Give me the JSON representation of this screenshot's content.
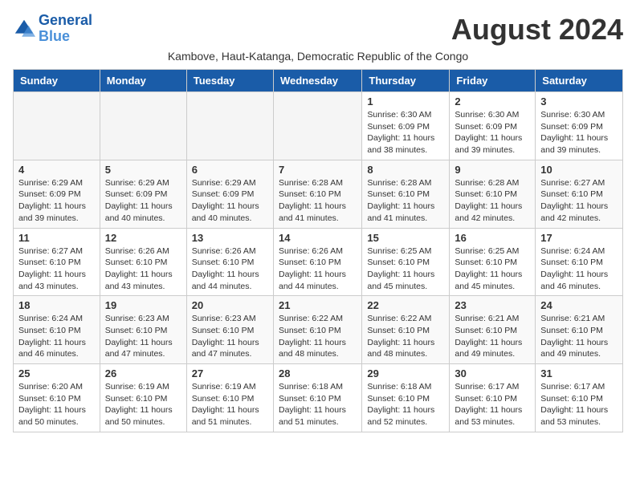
{
  "logo": {
    "line1": "General",
    "line2": "Blue"
  },
  "title": "August 2024",
  "subtitle": "Kambove, Haut-Katanga, Democratic Republic of the Congo",
  "headers": [
    "Sunday",
    "Monday",
    "Tuesday",
    "Wednesday",
    "Thursday",
    "Friday",
    "Saturday"
  ],
  "weeks": [
    [
      {
        "day": "",
        "info": ""
      },
      {
        "day": "",
        "info": ""
      },
      {
        "day": "",
        "info": ""
      },
      {
        "day": "",
        "info": ""
      },
      {
        "day": "1",
        "info": "Sunrise: 6:30 AM\nSunset: 6:09 PM\nDaylight: 11 hours\nand 38 minutes."
      },
      {
        "day": "2",
        "info": "Sunrise: 6:30 AM\nSunset: 6:09 PM\nDaylight: 11 hours\nand 39 minutes."
      },
      {
        "day": "3",
        "info": "Sunrise: 6:30 AM\nSunset: 6:09 PM\nDaylight: 11 hours\nand 39 minutes."
      }
    ],
    [
      {
        "day": "4",
        "info": "Sunrise: 6:29 AM\nSunset: 6:09 PM\nDaylight: 11 hours\nand 39 minutes."
      },
      {
        "day": "5",
        "info": "Sunrise: 6:29 AM\nSunset: 6:09 PM\nDaylight: 11 hours\nand 40 minutes."
      },
      {
        "day": "6",
        "info": "Sunrise: 6:29 AM\nSunset: 6:09 PM\nDaylight: 11 hours\nand 40 minutes."
      },
      {
        "day": "7",
        "info": "Sunrise: 6:28 AM\nSunset: 6:10 PM\nDaylight: 11 hours\nand 41 minutes."
      },
      {
        "day": "8",
        "info": "Sunrise: 6:28 AM\nSunset: 6:10 PM\nDaylight: 11 hours\nand 41 minutes."
      },
      {
        "day": "9",
        "info": "Sunrise: 6:28 AM\nSunset: 6:10 PM\nDaylight: 11 hours\nand 42 minutes."
      },
      {
        "day": "10",
        "info": "Sunrise: 6:27 AM\nSunset: 6:10 PM\nDaylight: 11 hours\nand 42 minutes."
      }
    ],
    [
      {
        "day": "11",
        "info": "Sunrise: 6:27 AM\nSunset: 6:10 PM\nDaylight: 11 hours\nand 43 minutes."
      },
      {
        "day": "12",
        "info": "Sunrise: 6:26 AM\nSunset: 6:10 PM\nDaylight: 11 hours\nand 43 minutes."
      },
      {
        "day": "13",
        "info": "Sunrise: 6:26 AM\nSunset: 6:10 PM\nDaylight: 11 hours\nand 44 minutes."
      },
      {
        "day": "14",
        "info": "Sunrise: 6:26 AM\nSunset: 6:10 PM\nDaylight: 11 hours\nand 44 minutes."
      },
      {
        "day": "15",
        "info": "Sunrise: 6:25 AM\nSunset: 6:10 PM\nDaylight: 11 hours\nand 45 minutes."
      },
      {
        "day": "16",
        "info": "Sunrise: 6:25 AM\nSunset: 6:10 PM\nDaylight: 11 hours\nand 45 minutes."
      },
      {
        "day": "17",
        "info": "Sunrise: 6:24 AM\nSunset: 6:10 PM\nDaylight: 11 hours\nand 46 minutes."
      }
    ],
    [
      {
        "day": "18",
        "info": "Sunrise: 6:24 AM\nSunset: 6:10 PM\nDaylight: 11 hours\nand 46 minutes."
      },
      {
        "day": "19",
        "info": "Sunrise: 6:23 AM\nSunset: 6:10 PM\nDaylight: 11 hours\nand 47 minutes."
      },
      {
        "day": "20",
        "info": "Sunrise: 6:23 AM\nSunset: 6:10 PM\nDaylight: 11 hours\nand 47 minutes."
      },
      {
        "day": "21",
        "info": "Sunrise: 6:22 AM\nSunset: 6:10 PM\nDaylight: 11 hours\nand 48 minutes."
      },
      {
        "day": "22",
        "info": "Sunrise: 6:22 AM\nSunset: 6:10 PM\nDaylight: 11 hours\nand 48 minutes."
      },
      {
        "day": "23",
        "info": "Sunrise: 6:21 AM\nSunset: 6:10 PM\nDaylight: 11 hours\nand 49 minutes."
      },
      {
        "day": "24",
        "info": "Sunrise: 6:21 AM\nSunset: 6:10 PM\nDaylight: 11 hours\nand 49 minutes."
      }
    ],
    [
      {
        "day": "25",
        "info": "Sunrise: 6:20 AM\nSunset: 6:10 PM\nDaylight: 11 hours\nand 50 minutes."
      },
      {
        "day": "26",
        "info": "Sunrise: 6:19 AM\nSunset: 6:10 PM\nDaylight: 11 hours\nand 50 minutes."
      },
      {
        "day": "27",
        "info": "Sunrise: 6:19 AM\nSunset: 6:10 PM\nDaylight: 11 hours\nand 51 minutes."
      },
      {
        "day": "28",
        "info": "Sunrise: 6:18 AM\nSunset: 6:10 PM\nDaylight: 11 hours\nand 51 minutes."
      },
      {
        "day": "29",
        "info": "Sunrise: 6:18 AM\nSunset: 6:10 PM\nDaylight: 11 hours\nand 52 minutes."
      },
      {
        "day": "30",
        "info": "Sunrise: 6:17 AM\nSunset: 6:10 PM\nDaylight: 11 hours\nand 53 minutes."
      },
      {
        "day": "31",
        "info": "Sunrise: 6:17 AM\nSunset: 6:10 PM\nDaylight: 11 hours\nand 53 minutes."
      }
    ]
  ]
}
